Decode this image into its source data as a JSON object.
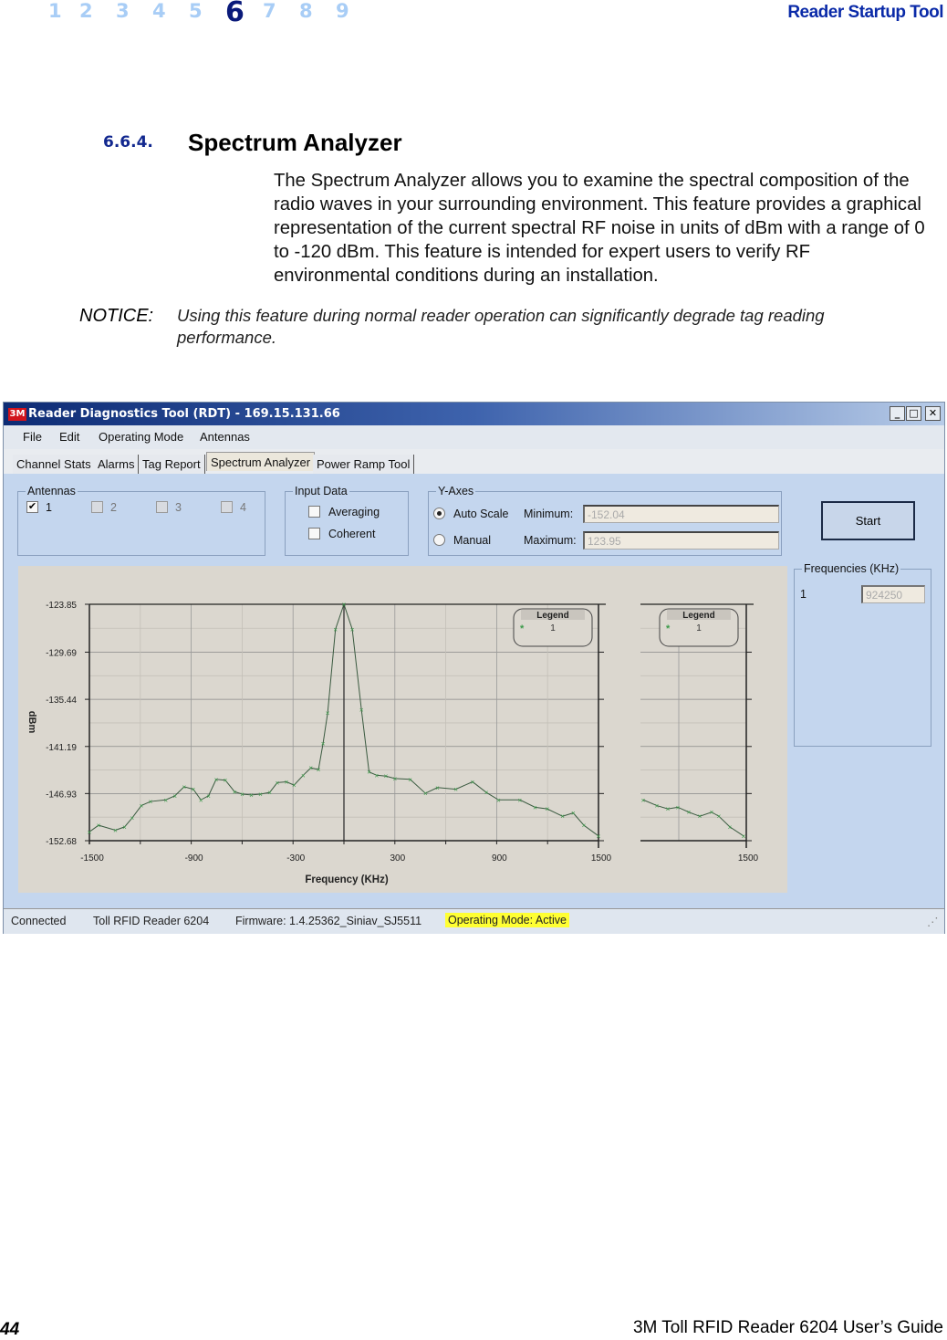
{
  "header": {
    "chapters": [
      "1",
      "2",
      "3",
      "4",
      "5",
      "6",
      "7",
      "8",
      "9"
    ],
    "current_chapter": "6",
    "title": "Reader Startup Tool"
  },
  "section": {
    "number": "6.6.4.",
    "title": "Spectrum Analyzer",
    "body": "The Spectrum Analyzer allows you to examine the spectral composition of the radio waves in your surrounding environment. This feature provides a graphical representation of the current spectral RF noise in units of dBm with a range of 0 to -120 dBm. This feature is intended for expert users to verify RF environmental conditions during an installation.",
    "notice_label": "NOTICE:",
    "notice_text": "Using this feature during normal reader operation can significantly degrade tag reading performance."
  },
  "app": {
    "title": "Reader Diagnostics Tool (RDT) - 169.15.131.66",
    "logo": "3M",
    "menu": [
      "File",
      "Edit",
      "Operating Mode",
      "Antennas"
    ],
    "tabs": [
      "Channel Stats",
      "Alarms",
      "Tag Report",
      "Spectrum Analyzer",
      "Power Ramp Tool"
    ],
    "active_tab": "Spectrum Analyzer",
    "antennas": {
      "label": "Antennas",
      "items": [
        {
          "label": "1",
          "checked": true
        },
        {
          "label": "2",
          "checked": false
        },
        {
          "label": "3",
          "checked": false
        },
        {
          "label": "4",
          "checked": false
        }
      ]
    },
    "input_data": {
      "label": "Input Data",
      "averaging": "Averaging",
      "coherent": "Coherent"
    },
    "y_axes": {
      "label": "Y-Axes",
      "auto_scale": "Auto Scale",
      "manual": "Manual",
      "selected": "Auto Scale",
      "min_label": "Minimum:",
      "min_value": "-152.04",
      "max_label": "Maximum:",
      "max_value": "123.95"
    },
    "start_label": "Start",
    "frequencies": {
      "label": "Frequencies (KHz)",
      "index": "1",
      "value": "924250"
    },
    "status": {
      "connection": "Connected",
      "reader": "Toll RFID Reader 6204",
      "firmware": "Firmware: 1.4.25362_Siniav_SJ5511",
      "mode": "Operating Mode: Active"
    },
    "colors": {
      "series": "#3c9a4a",
      "mode_highlight": "#ffff33",
      "titlebar": "#0d2b74"
    }
  },
  "chart_data": {
    "type": "line",
    "xlabel": "Frequency (KHz)",
    "ylabel": "dBm",
    "grid": true,
    "legend_position": "top-right",
    "legend": {
      "title": "Legend",
      "entries": [
        "1"
      ]
    },
    "xlim": [
      -1500,
      1500
    ],
    "ylim": [
      -152.68,
      -123.85
    ],
    "x_ticks": [
      "-1500",
      "-900",
      "-300",
      "300",
      "900",
      "1500"
    ],
    "y_ticks": [
      "-123.85",
      "-129.69",
      "-135.44",
      "-141.19",
      "-146.93",
      "-152.68"
    ],
    "series": [
      {
        "name": "1",
        "x": [
          -1500,
          -1446,
          -1347,
          -1293,
          -1248,
          -1194,
          -1140,
          -1050,
          -996,
          -942,
          -888,
          -843,
          -798,
          -753,
          -699,
          -645,
          -600,
          -546,
          -492,
          -438,
          -393,
          -339,
          -294,
          -240,
          -195,
          -150,
          -123,
          -96,
          -50,
          0,
          49,
          103,
          148,
          193,
          247,
          300,
          390,
          480,
          551,
          659,
          758,
          839,
          911,
          1037,
          1126,
          1198,
          1288,
          1351,
          1414,
          1500
        ],
        "y": [
          -151.6,
          -150.8,
          -151.4,
          -151.0,
          -149.9,
          -148.4,
          -147.9,
          -147.7,
          -147.2,
          -146.1,
          -146.4,
          -147.7,
          -147.2,
          -145.2,
          -145.3,
          -146.7,
          -147.0,
          -147.1,
          -147.0,
          -146.8,
          -145.6,
          -145.5,
          -145.9,
          -144.7,
          -143.8,
          -144.0,
          -140.8,
          -137.1,
          -126.9,
          -123.85,
          -126.9,
          -136.7,
          -144.3,
          -144.7,
          -144.8,
          -145.1,
          -145.2,
          -146.9,
          -146.2,
          -146.4,
          -145.5,
          -146.8,
          -147.7,
          -147.7,
          -148.6,
          -148.8,
          -149.7,
          -149.3,
          -150.8,
          -152.1
        ]
      }
    ],
    "mini_chart": {
      "x_ticks": [
        "1500"
      ],
      "legend": {
        "title": "Legend",
        "entries": [
          "1"
        ]
      },
      "y": [
        -147.7,
        -148.4,
        -148.8,
        -148.6,
        -149.2,
        -149.7,
        -149.2,
        -149.7,
        -151.0,
        -152.1
      ]
    }
  },
  "footer": {
    "page": "44",
    "guide": "3M Toll RFID Reader 6204 User’s Guide"
  }
}
